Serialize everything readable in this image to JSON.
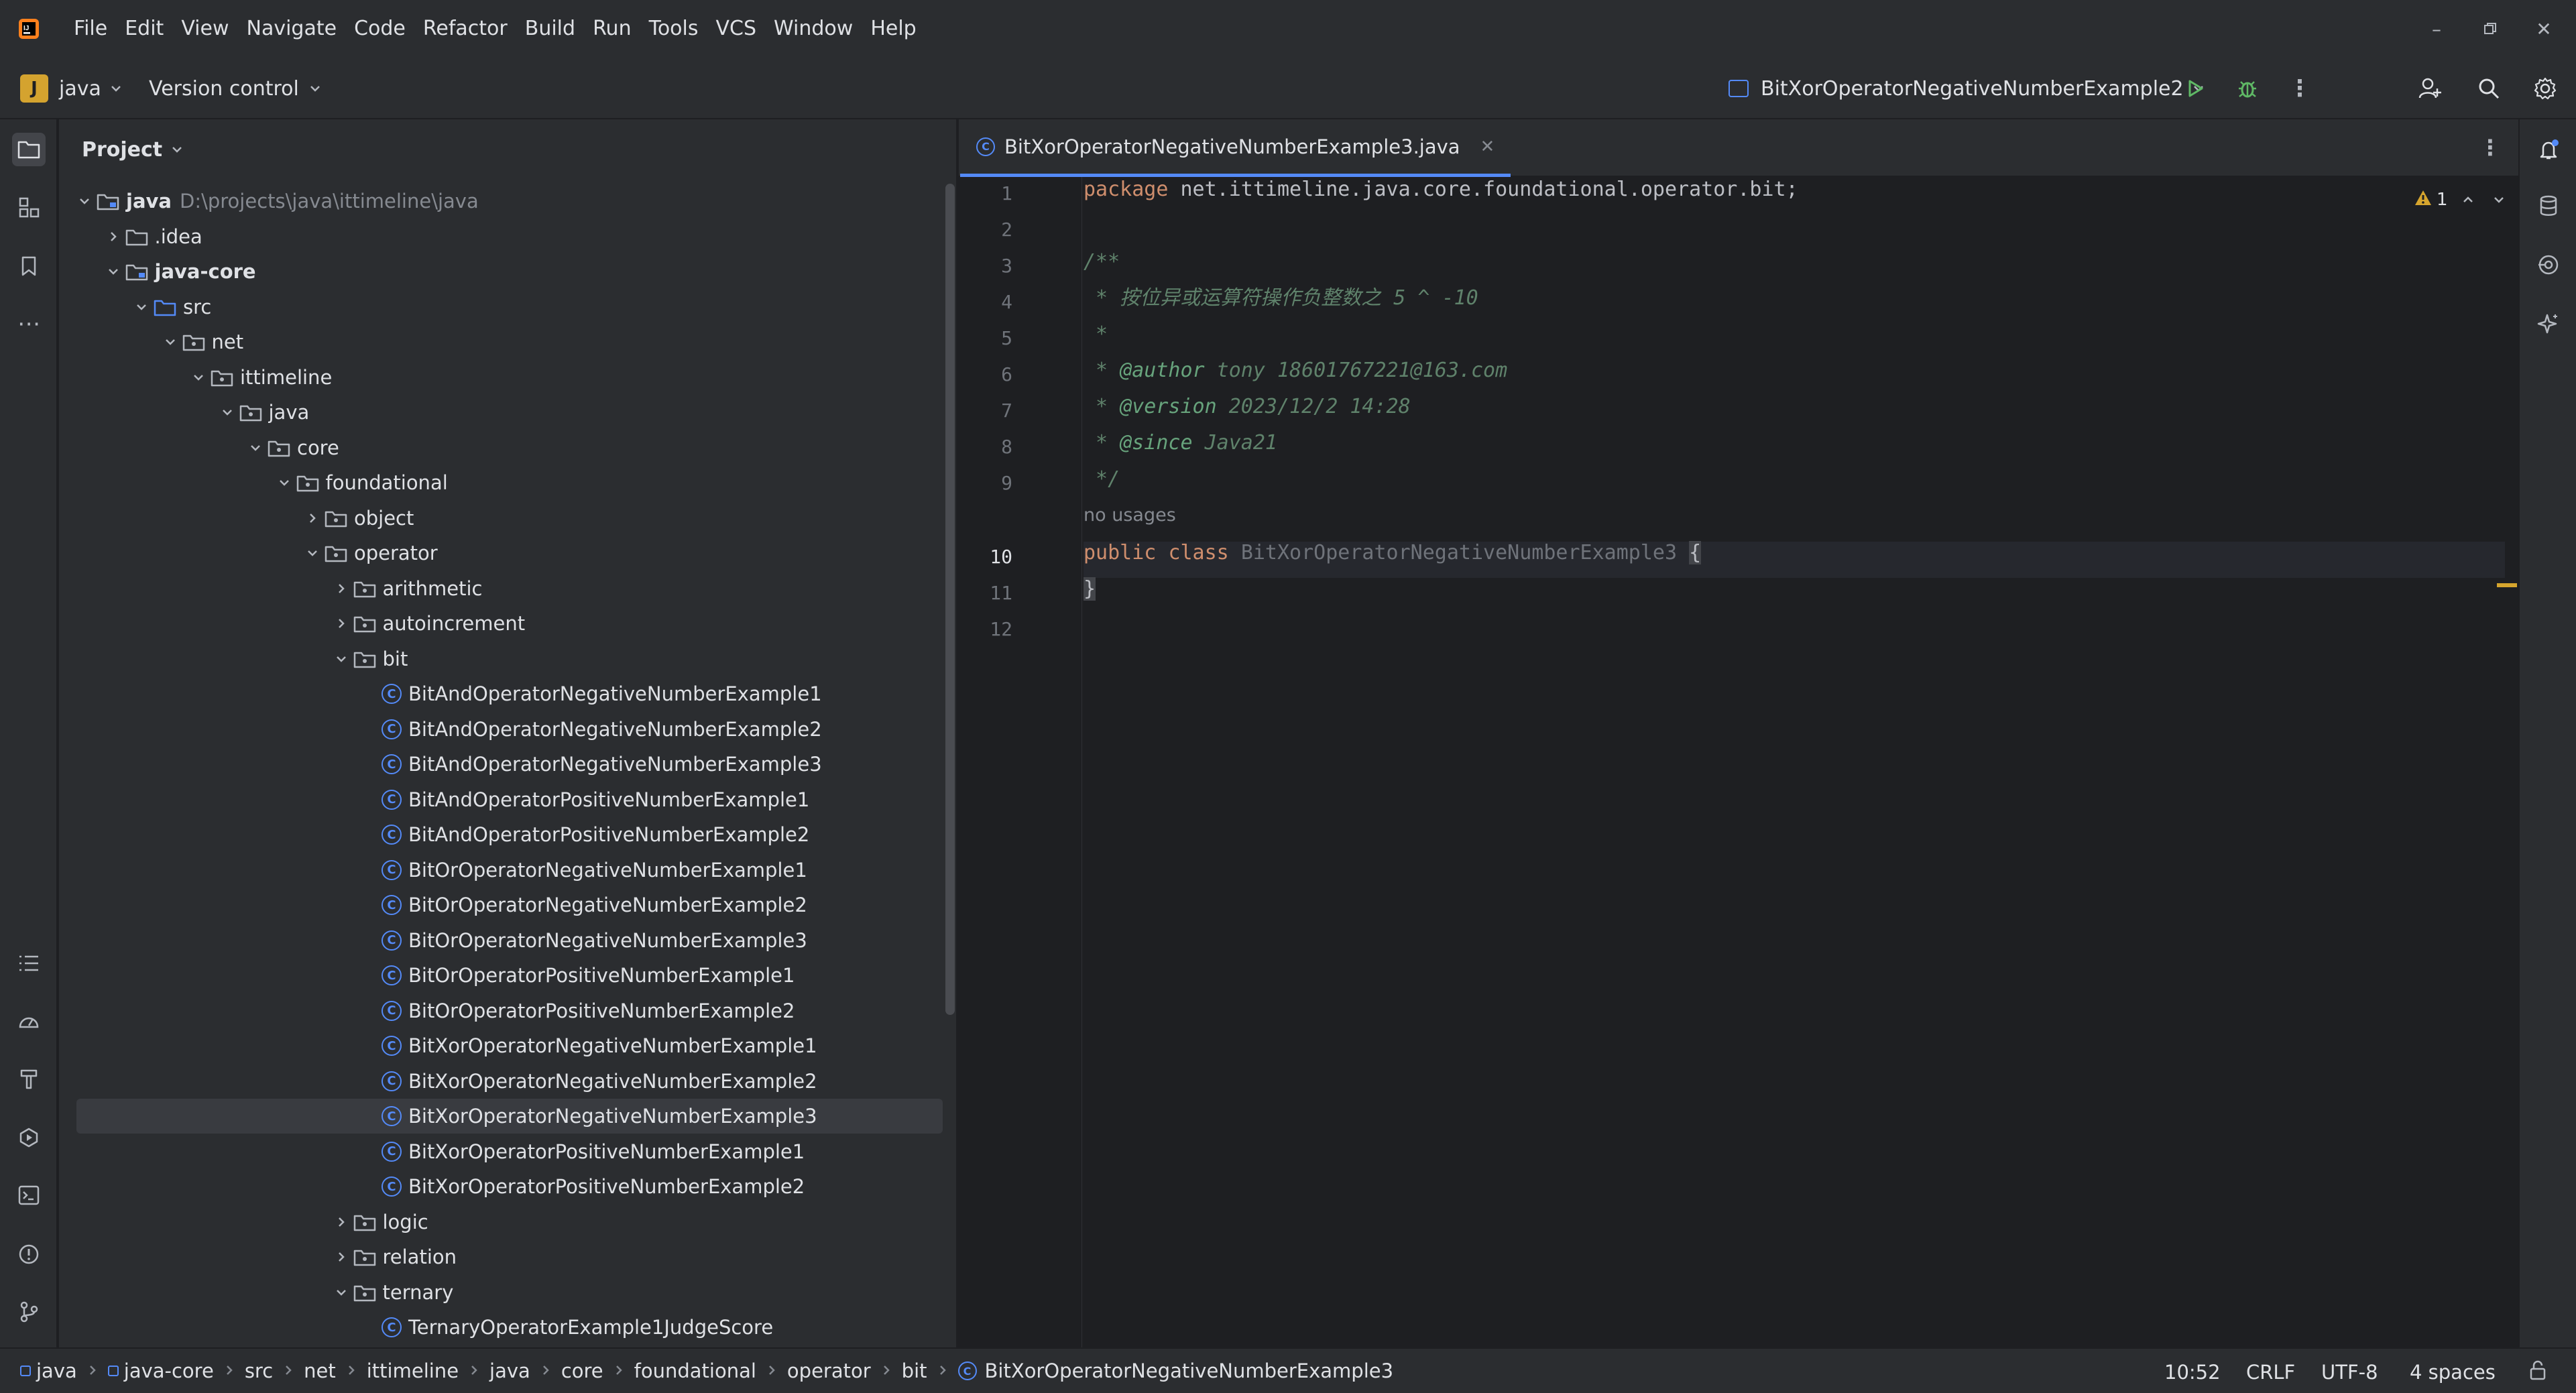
{
  "menu": [
    "File",
    "Edit",
    "View",
    "Navigate",
    "Code",
    "Refactor",
    "Build",
    "Run",
    "Tools",
    "VCS",
    "Window",
    "Help"
  ],
  "toolbar": {
    "project_badge": "J",
    "project_name": "java",
    "vcs_label": "Version control",
    "run_config": "BitXorOperatorNegativeNumberExample2"
  },
  "project_panel": {
    "title": "Project",
    "tree": [
      {
        "label": "java",
        "hint": "D:\\projects\\java\\ittimeline\\java",
        "type": "module",
        "depth": 0,
        "expanded": true
      },
      {
        "label": ".idea",
        "type": "folder",
        "depth": 1,
        "expanded": false
      },
      {
        "label": "java-core",
        "type": "module",
        "depth": 1,
        "expanded": true
      },
      {
        "label": "src",
        "type": "source",
        "depth": 2,
        "expanded": true
      },
      {
        "label": "net",
        "type": "package",
        "depth": 3,
        "expanded": true
      },
      {
        "label": "ittimeline",
        "type": "package",
        "depth": 4,
        "expanded": true
      },
      {
        "label": "java",
        "type": "package",
        "depth": 5,
        "expanded": true
      },
      {
        "label": "core",
        "type": "package",
        "depth": 6,
        "expanded": true
      },
      {
        "label": "foundational",
        "type": "package",
        "depth": 7,
        "expanded": true
      },
      {
        "label": "object",
        "type": "package",
        "depth": 8,
        "expanded": false
      },
      {
        "label": "operator",
        "type": "package",
        "depth": 8,
        "expanded": true
      },
      {
        "label": "arithmetic",
        "type": "package",
        "depth": 9,
        "expanded": false
      },
      {
        "label": "autoincrement",
        "type": "package",
        "depth": 9,
        "expanded": false
      },
      {
        "label": "bit",
        "type": "package",
        "depth": 9,
        "expanded": true
      },
      {
        "label": "BitAndOperatorNegativeNumberExample1",
        "type": "class",
        "depth": 10
      },
      {
        "label": "BitAndOperatorNegativeNumberExample2",
        "type": "class",
        "depth": 10
      },
      {
        "label": "BitAndOperatorNegativeNumberExample3",
        "type": "class",
        "depth": 10
      },
      {
        "label": "BitAndOperatorPositiveNumberExample1",
        "type": "class",
        "depth": 10
      },
      {
        "label": "BitAndOperatorPositiveNumberExample2",
        "type": "class",
        "depth": 10
      },
      {
        "label": "BitOrOperatorNegativeNumberExample1",
        "type": "class",
        "depth": 10
      },
      {
        "label": "BitOrOperatorNegativeNumberExample2",
        "type": "class",
        "depth": 10
      },
      {
        "label": "BitOrOperatorNegativeNumberExample3",
        "type": "class",
        "depth": 10
      },
      {
        "label": "BitOrOperatorPositiveNumberExample1",
        "type": "class",
        "depth": 10
      },
      {
        "label": "BitOrOperatorPositiveNumberExample2",
        "type": "class",
        "depth": 10
      },
      {
        "label": "BitXorOperatorNegativeNumberExample1",
        "type": "class",
        "depth": 10
      },
      {
        "label": "BitXorOperatorNegativeNumberExample2",
        "type": "class",
        "depth": 10
      },
      {
        "label": "BitXorOperatorNegativeNumberExample3",
        "type": "class",
        "depth": 10,
        "selected": true
      },
      {
        "label": "BitXorOperatorPositiveNumberExample1",
        "type": "class",
        "depth": 10
      },
      {
        "label": "BitXorOperatorPositiveNumberExample2",
        "type": "class",
        "depth": 10
      },
      {
        "label": "logic",
        "type": "package",
        "depth": 9,
        "expanded": false
      },
      {
        "label": "relation",
        "type": "package",
        "depth": 9,
        "expanded": false
      },
      {
        "label": "ternary",
        "type": "package",
        "depth": 9,
        "expanded": true
      },
      {
        "label": "TernaryOperatorExample1JudgeScore",
        "type": "class",
        "depth": 10
      }
    ]
  },
  "editor": {
    "tab_label": "BitXorOperatorNegativeNumberExample3.java",
    "warning_count": "1",
    "line_numbers": [
      "1",
      "2",
      "3",
      "4",
      "5",
      "6",
      "7",
      "8",
      "9",
      "10",
      "11",
      "12"
    ],
    "code": {
      "l1_kw": "package",
      "l1_rest": " net.ittimeline.java.core.foundational.operator.bit;",
      "l3": "/**",
      "l4": " * 按位异或运算符操作负整数之 5 ^ -10",
      "l5": " *",
      "l6_star": " * ",
      "l6_tag": "@author",
      "l6_rest": " tony 18601767221@163.com",
      "l7_star": " * ",
      "l7_tag": "@version",
      "l7_rest": " 2023/12/2 14:28",
      "l8_star": " * ",
      "l8_tag": "@since",
      "l8_rest": " Java21",
      "l9": " */",
      "usages_hint": "no usages",
      "l10_kw1": "public",
      "l10_kw2": "class",
      "l10_name": "BitXorOperatorNegativeNumberExample3",
      "l10_brace": "{",
      "l11": "}"
    }
  },
  "statusbar": {
    "breadcrumbs": [
      "java",
      "java-core",
      "src",
      "net",
      "ittimeline",
      "java",
      "core",
      "foundational",
      "operator",
      "bit",
      "BitXorOperatorNegativeNumberExample3"
    ],
    "position": "10:52",
    "line_sep": "CRLF",
    "encoding": "UTF-8",
    "indent": "4 spaces"
  },
  "colors": {
    "accent": "#548af7",
    "background": "#1e1f22",
    "panel": "#2b2d30",
    "selection": "#393b40"
  }
}
